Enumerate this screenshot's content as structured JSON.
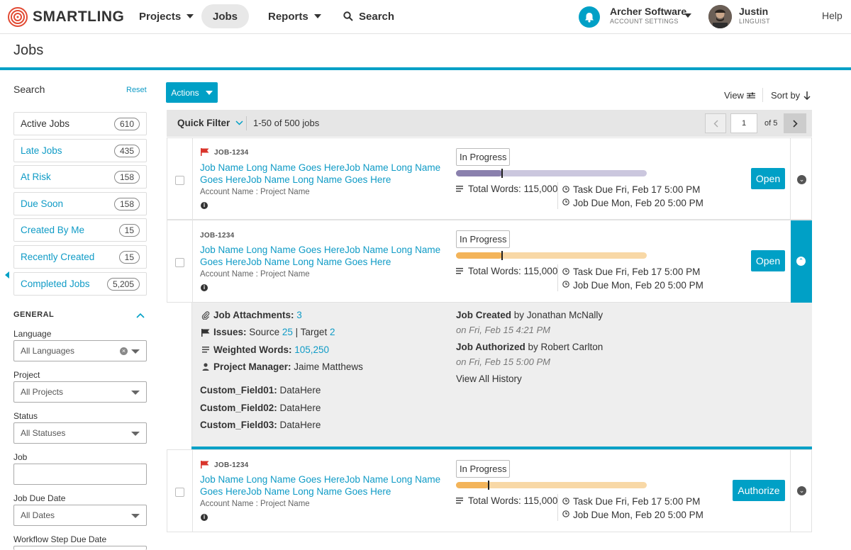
{
  "header": {
    "logo": "SMARTLING",
    "nav": [
      {
        "label": "Projects"
      },
      {
        "label": "Jobs"
      },
      {
        "label": "Reports"
      },
      {
        "label": "Search"
      }
    ],
    "account_name": "Archer Software",
    "account_sub": "ACCOUNT SETTINGS",
    "user_name": "Justin",
    "user_role": "LINGUIST",
    "help": "Help"
  },
  "page_title": "Jobs",
  "sidebar": {
    "search_label": "Search",
    "reset": "Reset",
    "filters": [
      {
        "label": "Active Jobs",
        "count": "610"
      },
      {
        "label": "Late Jobs",
        "count": "435"
      },
      {
        "label": "At Risk",
        "count": "158"
      },
      {
        "label": "Due Soon",
        "count": "158"
      },
      {
        "label": "Created By Me",
        "count": "15"
      },
      {
        "label": "Recently Created",
        "count": "15"
      },
      {
        "label": "Completed Jobs",
        "count": "5,205"
      }
    ],
    "general": "GENERAL",
    "language_label": "Language",
    "language_value": "All Languages",
    "project_label": "Project",
    "project_value": "All Projects",
    "status_label": "Status",
    "status_value": "All Statuses",
    "job_label": "Job",
    "job_due_label": "Job Due Date",
    "job_due_value": "All Dates",
    "workflow_label": "Workflow Step Due Date"
  },
  "toolbar": {
    "actions": "Actions",
    "view": "View",
    "sort": "Sort by"
  },
  "list": {
    "quick_filter": "Quick Filter",
    "range": "1-50 of 500 jobs",
    "page": "1",
    "of": "of 5"
  },
  "jobs": [
    {
      "id": "JOB-1234",
      "name": "Job Name Long Name Goes HereJob Name Long Name Goes HereJob Name Long Name Goes Here",
      "account": "Account Name : Project Name",
      "status": "In Progress",
      "progress": 0.24,
      "words": "Total Words: 115,000",
      "task_due": "Task Due Fri, Feb 17 5:00 PM",
      "job_due": "Job Due Mon, Feb 20 5:00 PM",
      "action": "Open",
      "bar_color": "#8a80ad",
      "bar_bg": "#cbc7de"
    },
    {
      "id": "JOB-1234",
      "name": "Job Name Long Name Goes HereJob Name Long Name Goes HereJob Name Long Name Goes Here",
      "account": "Account Name : Project Name",
      "status": "In Progress",
      "progress": 0.24,
      "words": "Total Words: 115,000",
      "task_due": "Task Due Fri, Feb 17 5:00 PM",
      "job_due": "Job Due Mon, Feb 20 5:00 PM",
      "action": "Open",
      "bar_color": "#f3b45a",
      "bar_bg": "#f8d8a6"
    },
    {
      "id": "JOB-1234",
      "name": "Job Name Long Name Goes HereJob Name Long Name Goes HereJob Name Long Name Goes Here",
      "account": "Account Name : Project Name",
      "status": "In Progress",
      "progress": 0.17,
      "words": "Total Words: 115,000",
      "task_due": "Task Due Fri, Feb 17 5:00 PM",
      "job_due": "Job Due Mon, Feb 20 5:00 PM",
      "action": "Authorize",
      "bar_color": "#f3b45a",
      "bar_bg": "#f8d8a6"
    }
  ],
  "details": {
    "attachments_label": "Job Attachments:",
    "attachments_count": "3",
    "issues_label": "Issues:",
    "issues_source": "Source",
    "issues_source_count": "25",
    "issues_sep": "|",
    "issues_target": "Target",
    "issues_target_count": "2",
    "weighted_label": "Weighted Words:",
    "weighted_value": "105,250",
    "pm_label": "Project Manager:",
    "pm_value": "Jaime Matthews",
    "custom1_label": "Custom_Field01:",
    "custom1_value": "DataHere",
    "custom2_label": "Custom_Field02:",
    "custom2_value": "DataHere",
    "custom3_label": "Custom_Field03:",
    "custom3_value": "DataHere",
    "created_label": "Job Created",
    "created_by": "by Jonathan McNally",
    "created_on": "on Fri, Feb 15 4:21 PM",
    "authorized_label": "Job Authorized",
    "authorized_by": "by Robert Carlton",
    "authorized_on": "on Fri, Feb 15 5:00 PM",
    "history": "View All History"
  },
  "colors": {
    "accent": "#00a0c6",
    "link": "#0f9bc6",
    "flag": "#d9342b"
  }
}
